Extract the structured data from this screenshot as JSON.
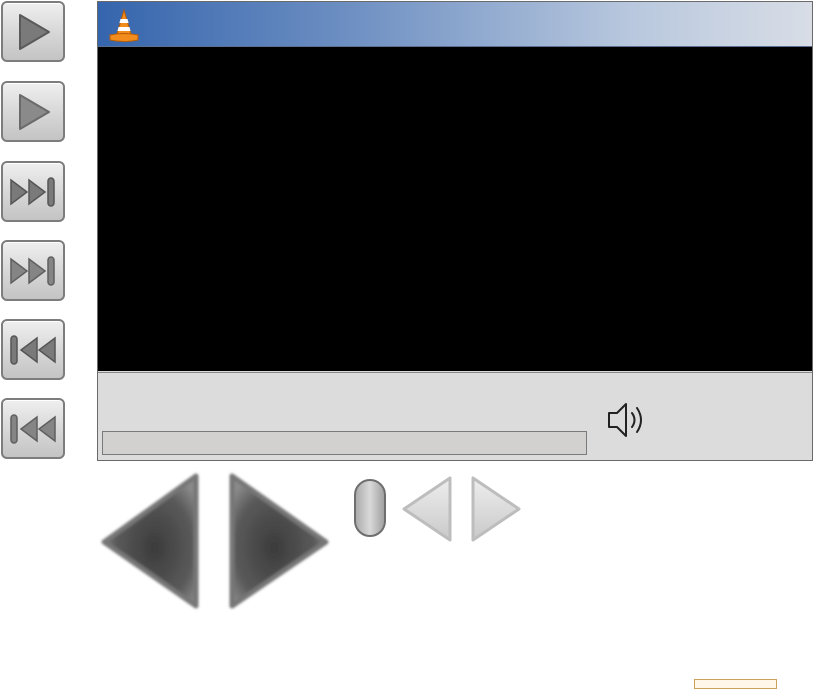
{
  "side_buttons": [
    {
      "name": "play-button",
      "icon": "play-icon"
    },
    {
      "name": "play-button-pressed",
      "icon": "play-icon"
    },
    {
      "name": "next-button",
      "icon": "skip-forward-icon"
    },
    {
      "name": "next-button-pressed",
      "icon": "skip-forward-icon"
    },
    {
      "name": "previous-button",
      "icon": "skip-back-icon"
    },
    {
      "name": "previous-button-pressed",
      "icon": "skip-back-icon"
    }
  ],
  "window": {
    "app_icon": "vlc-cone-icon",
    "title_gradient": [
      "#3565ad",
      "#d8dde6"
    ],
    "video_background": "#000000",
    "volume_icon": "speaker-icon"
  },
  "playback": {
    "progress_fraction": 0
  },
  "colors": {
    "button_border": "#7d7d7d",
    "panel": "#dcdcdc",
    "cone_orange": "#f28c1d"
  }
}
